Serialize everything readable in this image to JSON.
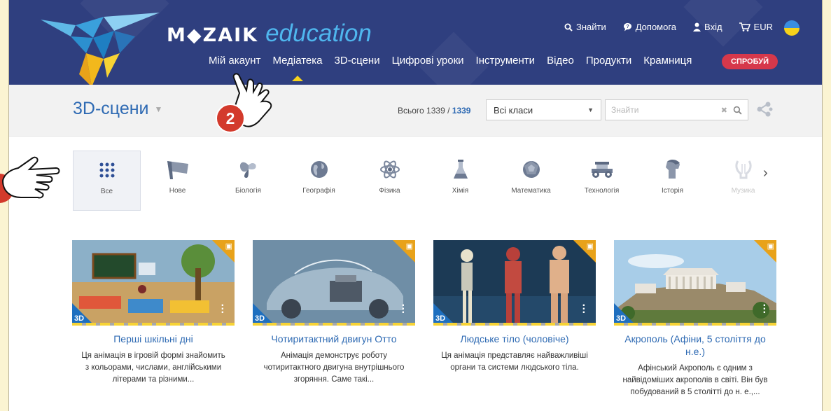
{
  "brand": {
    "mozaik": "M◆ZAIK",
    "education": "education"
  },
  "topbar": {
    "search": "Знайти",
    "help": "Допомога",
    "login": "Вхід",
    "currency": "EUR"
  },
  "nav": {
    "items": [
      "Мій акаунт",
      "Медіатека",
      "3D-сцени",
      "Цифрові уроки",
      "Інструменти",
      "Відео",
      "Продукти",
      "Крамниця"
    ],
    "active": "Медіатека",
    "try": "СПРОБУЙ"
  },
  "section": {
    "title": "3D-сцени"
  },
  "stats": {
    "label": "Всього 1339 /",
    "total": "1339"
  },
  "filters": {
    "class": "Всі класи",
    "search_placeholder": "Знайти"
  },
  "categories": [
    {
      "label": "Все",
      "icon": "grid-icon"
    },
    {
      "label": "Нове",
      "icon": "flag-icon"
    },
    {
      "label": "Біологія",
      "icon": "butterfly-icon"
    },
    {
      "label": "Географія",
      "icon": "globe-icon"
    },
    {
      "label": "Фізика",
      "icon": "atom-icon"
    },
    {
      "label": "Хімія",
      "icon": "flask-icon"
    },
    {
      "label": "Математика",
      "icon": "dice-icon"
    },
    {
      "label": "Технологія",
      "icon": "car-icon"
    },
    {
      "label": "Історія",
      "icon": "helmet-icon"
    },
    {
      "label": "Музика",
      "icon": "lyre-icon"
    }
  ],
  "cards": [
    {
      "title": "Перші шкільні дні",
      "desc": "Ця анімація в ігровій формі знайомить з кольорами, числами, англійськими літерами та різними..."
    },
    {
      "title": "Чотиритактний двигун Отто",
      "desc": "Анімація демонструє роботу чотиритактного двигуна внутрішнього згоряння. Саме такі..."
    },
    {
      "title": "Людське тіло (чоловіче)",
      "desc": "Ця анімація представляє найважливіші органи та системи людського тіла."
    },
    {
      "title": "Акрополь (Афіни, 5 століття до н.е.)",
      "desc": "Афінський Акрополь є одним з найвідоміших акрополів в світі. Він був побудований в 5 столітті до н. е.,..."
    }
  ],
  "badge_3d": "3D",
  "marker": "2",
  "colors": {
    "header": "#2f3f7f",
    "accent": "#2e6ab3",
    "gift": "#e8a21a",
    "try": "#d6384b",
    "marker": "#d33a2c",
    "page_bg": "#fbf4d2"
  }
}
